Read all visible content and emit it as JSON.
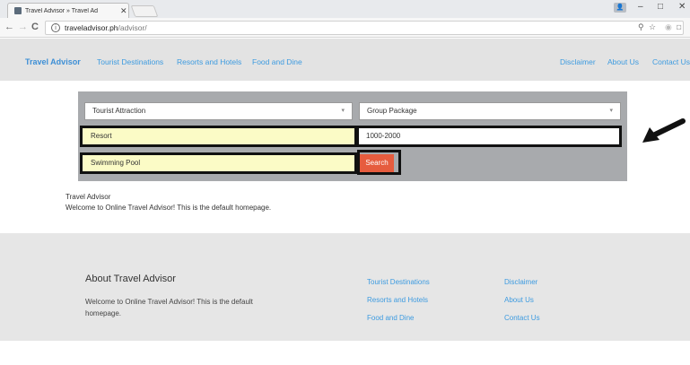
{
  "browser": {
    "tab_title": "Travel Advisor » Travel Ad",
    "tab_close": "✕",
    "url_host": "traveladvisor.ph",
    "url_path": "/advisor/",
    "back": "←",
    "forward": "→",
    "reload": "C",
    "info": "i",
    "zoom_icon": "🔍",
    "star_icon": "☆",
    "minimize": "–",
    "maximize": "□",
    "close": "✕",
    "more": "⋮"
  },
  "site": {
    "brand": "Travel Advisor",
    "nav_left": [
      "Tourist Destinations",
      "Resorts and Hotels",
      "Food and Dine"
    ],
    "nav_right": [
      "Disclaimer",
      "About Us",
      "Contact Us"
    ]
  },
  "search": {
    "category_select": "Tourist Attraction",
    "package_select": "Group Package",
    "type_field": "Resort",
    "price_field": "1000-2000",
    "amenity_field": "Swimming Pool",
    "button": "Search",
    "caret": "▾"
  },
  "intro": {
    "title": "Travel Advisor",
    "text": "Welcome to Online Travel Advisor! This is the default homepage."
  },
  "footer": {
    "title": "About Travel Advisor",
    "text": "Welcome to Online Travel Advisor! This is the default homepage.",
    "col1": [
      "Tourist Destinations",
      "Resorts and Hotels",
      "Food and Dine"
    ],
    "col2": [
      "Disclaimer",
      "About Us",
      "Contact Us"
    ]
  },
  "colors": {
    "accent_link": "#3d9be0",
    "search_button": "#e65c3e",
    "highlight_field": "#fbfbc6",
    "panel": "#a8aaad"
  }
}
